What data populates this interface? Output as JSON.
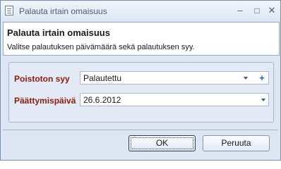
{
  "window": {
    "title": "Palauta irtain omaisuus",
    "icon": "document-icon",
    "controls": {
      "minimize": "–",
      "maximize": "□",
      "close": "✕"
    }
  },
  "header": {
    "title": "Palauta irtain omaisuus",
    "subtitle": "Valitse palautuksen päivämäärä sekä palautuksen syy."
  },
  "form": {
    "reason": {
      "label": "Poistoton syy",
      "value": "Palautettu",
      "add_symbol": "+"
    },
    "end_date": {
      "label": "Päättymispäivä",
      "value": "26.6.2012"
    }
  },
  "buttons": {
    "ok": "OK",
    "cancel": "Peruuta"
  },
  "colors": {
    "required_label": "#8a1b0d",
    "window_bg": "#dde6f3"
  }
}
